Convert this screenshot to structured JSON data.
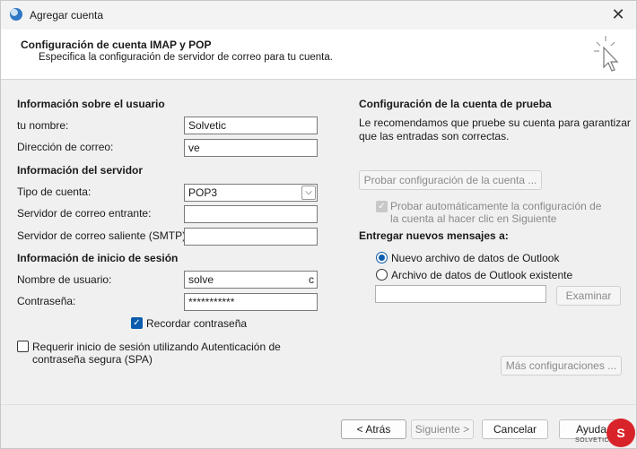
{
  "window": {
    "title": "Agregar cuenta",
    "close_glyph": "✕"
  },
  "header": {
    "title": "Configuración de cuenta IMAP y POP",
    "subtitle": "Especifica la configuración de servidor de correo para tu cuenta.",
    "icon": "cursor-sparkle-icon"
  },
  "user_info": {
    "heading": "Información sobre el usuario",
    "name_label": "tu nombre:",
    "name_value": "Solvetic",
    "email_label": "Dirección de correo:",
    "email_value": "ve"
  },
  "server_info": {
    "heading": "Información del servidor",
    "account_type_label": "Tipo de cuenta:",
    "account_type_value": "POP3",
    "incoming_label": "Servidor de correo entrante:",
    "incoming_value": "",
    "outgoing_label": "Servidor de correo saliente (SMTP):",
    "outgoing_value": ""
  },
  "login_info": {
    "heading": "Información de inicio de sesión",
    "username_label": "Nombre de usuario:",
    "username_value": "solve",
    "username_tail": "c",
    "password_label": "Contraseña:",
    "password_value": "***********",
    "remember_label": "Recordar contraseña",
    "remember_checked": true,
    "spa_label_line1": "Requerir inicio de sesión utilizando Autenticación de",
    "spa_label_line2": "contraseña segura (SPA)",
    "spa_checked": false
  },
  "test": {
    "heading": "Configuración de la cuenta de prueba",
    "desc_line1": "Le recomendamos que pruebe su cuenta para garantizar",
    "desc_line2": "que las entradas son correctas.",
    "test_button": "Probar configuración de la cuenta ...",
    "auto_test_line1": "Probar automáticamente la configuración de",
    "auto_test_line2": "la cuenta al hacer clic en Siguiente"
  },
  "deliver": {
    "heading": "Entregar nuevos mensajes a:",
    "option_new": "Nuevo archivo de datos de Outlook",
    "option_existing": "Archivo de datos de Outlook existente",
    "selected": "new",
    "path_value": "",
    "browse_button": "Examinar"
  },
  "more_settings_button": "Más configuraciones ...",
  "footer": {
    "back": "< Atrás",
    "next": "Siguiente >",
    "cancel": "Cancelar",
    "help": "Ayuda"
  },
  "watermark": {
    "letter": "S",
    "text": "SOLVETIC"
  }
}
